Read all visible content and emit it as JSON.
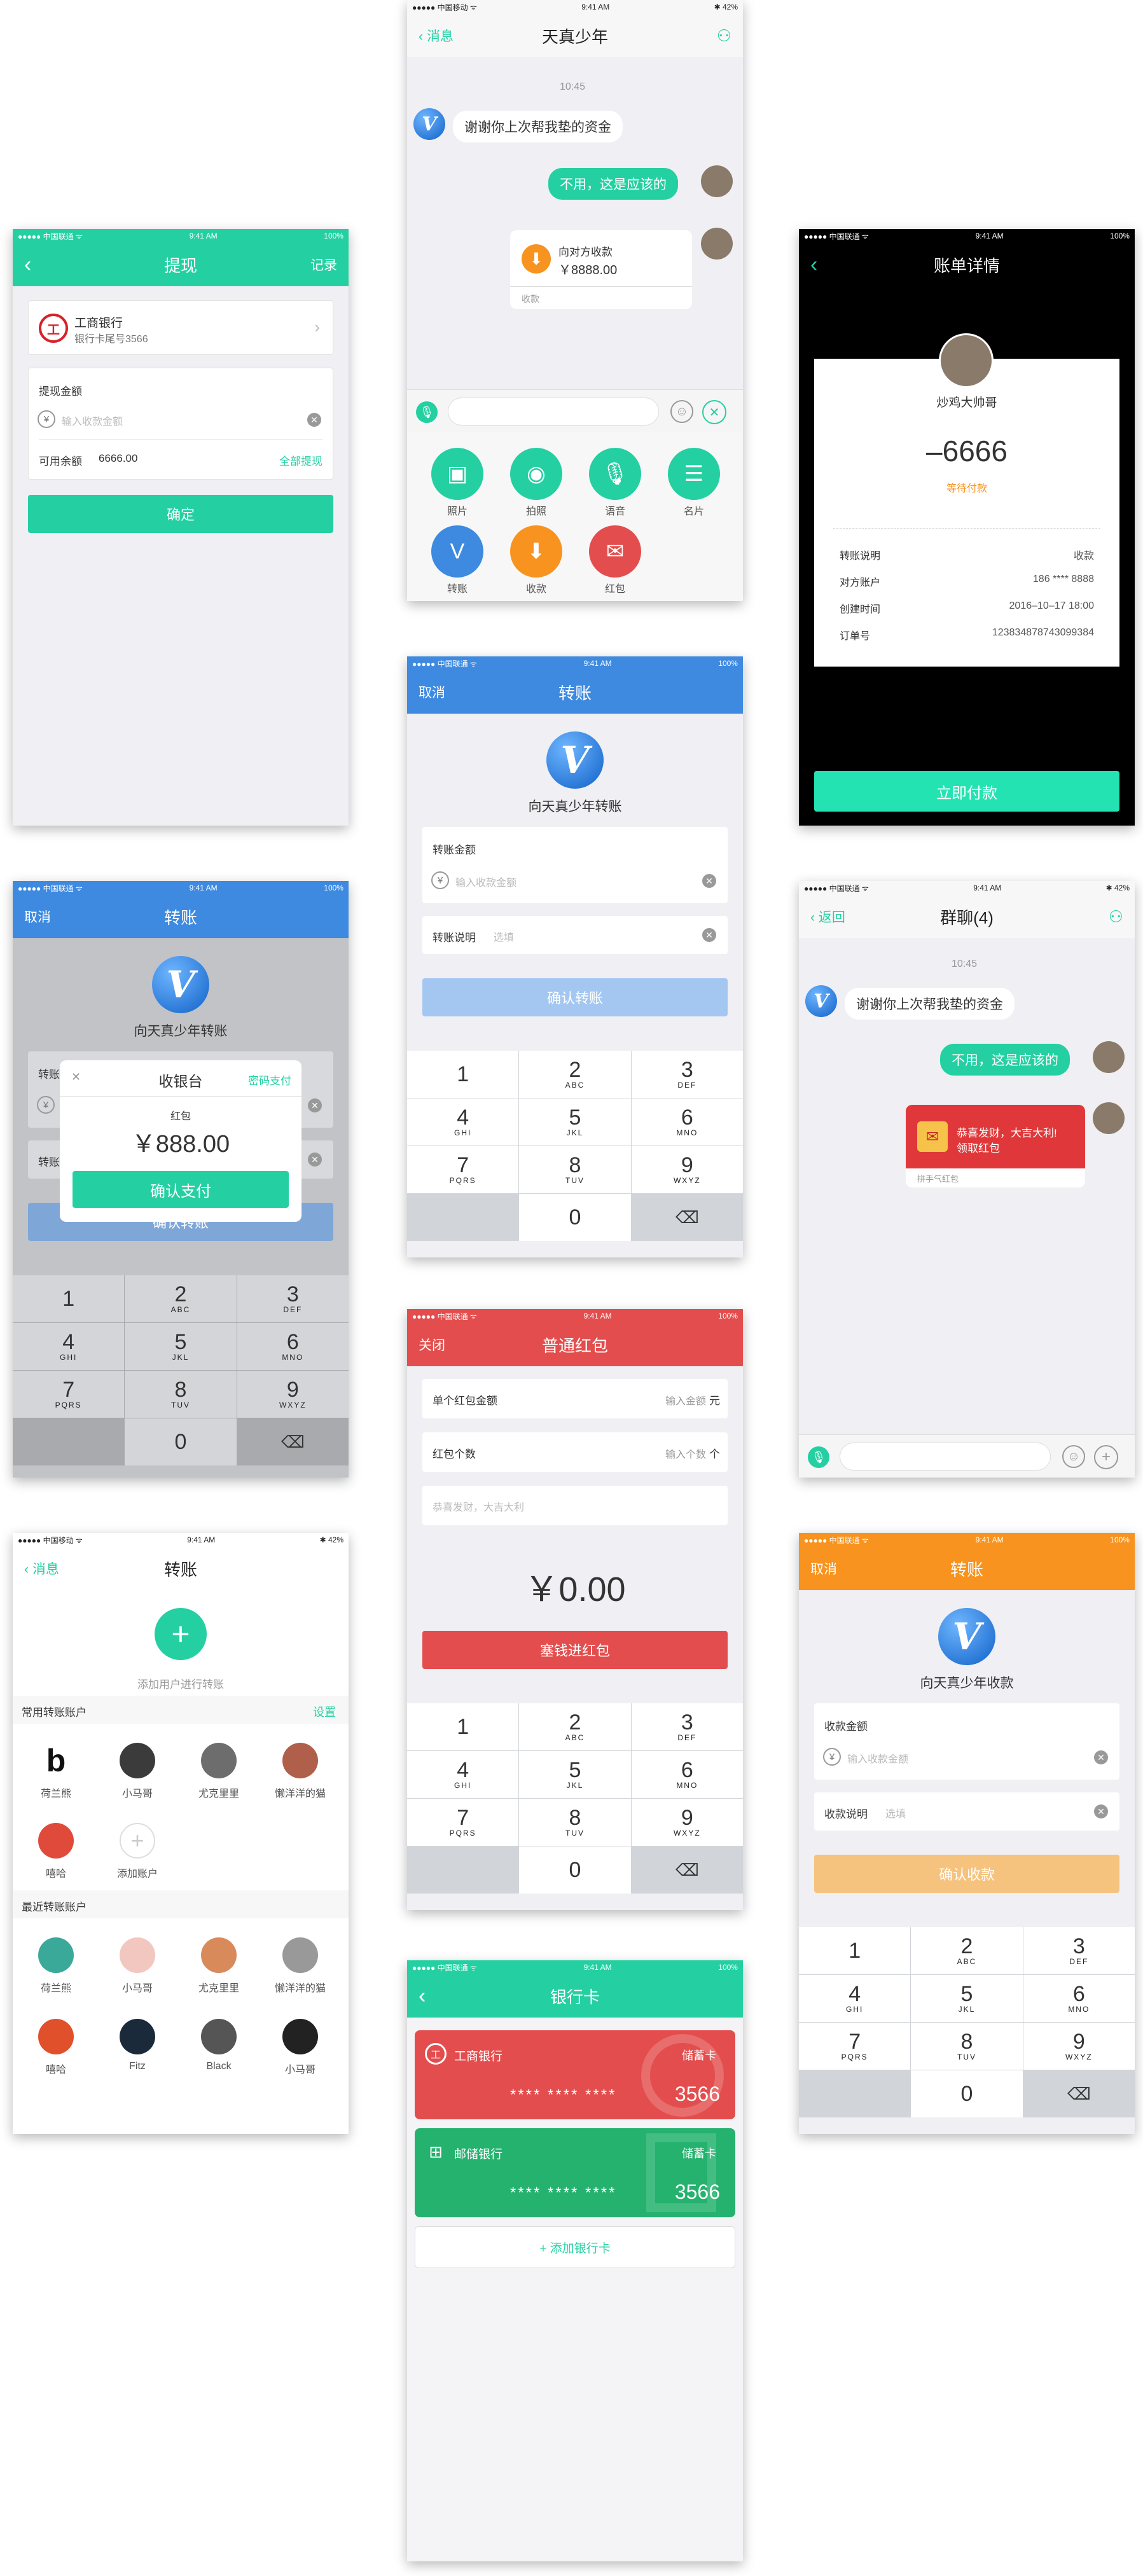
{
  "status": {
    "carrier_u": "●●●●● 中国联通 ᯤ",
    "carrier_m": "●●●●● 中国移动 ᯤ",
    "time": "9:41 AM",
    "battery": "100%",
    "battery42": "✱ 42%"
  },
  "withdraw": {
    "title": "提现",
    "back": "‹",
    "record": "记录",
    "bank_name": "工商银行",
    "bank_tail": "银行卡尾号3566",
    "amount_label": "提现金额",
    "amount_placeholder": "输入收款金额",
    "balance_label": "可用余额",
    "balance": "6666.00",
    "withdraw_all": "全部提现",
    "confirm": "确定"
  },
  "chat1": {
    "back": "消息",
    "title": "天真少年",
    "time": "10:45",
    "msg_in": "谢谢你上次帮我垫的资金",
    "msg_out": "不用，这是应该的",
    "req_title": "向对方收款",
    "req_amount": "￥8888.00",
    "req_tag": "收款",
    "tools": [
      "照片",
      "拍照",
      "语音",
      "名片",
      "转账",
      "收款",
      "红包"
    ]
  },
  "bill": {
    "title": "账单详情",
    "name": "炒鸡大帅哥",
    "amount": "–6666",
    "status": "等待付款",
    "rows": [
      [
        "转账说明",
        "收款"
      ],
      [
        "对方账户",
        "186 **** 8888"
      ],
      [
        "创建时间",
        "2016–10–17 18:00"
      ],
      [
        "订单号",
        "123834878743099384"
      ]
    ],
    "pay": "立即付款"
  },
  "transfer1": {
    "cancel": "取消",
    "title": "转账",
    "to": "向天真少年转账",
    "amount_label": "转账金额",
    "amount_placeholder": "输入收款金额",
    "note_label": "转账说明",
    "note_placeholder": "选填",
    "confirm": "确认转账"
  },
  "keypad": [
    [
      "1",
      ""
    ],
    [
      "2",
      "ABC"
    ],
    [
      "3",
      "DEF"
    ],
    [
      "4",
      "GHI"
    ],
    [
      "5",
      "JKL"
    ],
    [
      "6",
      "MNO"
    ],
    [
      "7",
      "PQRS"
    ],
    [
      "8",
      "TUV"
    ],
    [
      "9",
      "WXYZ"
    ],
    [
      "",
      ""
    ],
    [
      "0",
      ""
    ],
    [
      "⌫",
      ""
    ]
  ],
  "cashier": {
    "cancel": "取消",
    "title": "转账",
    "to": "向天真少年转账",
    "sheet_close": "✕",
    "sheet_title": "收银台",
    "pwd_pay": "密码支付",
    "item": "红包",
    "amount": "￥888.00",
    "confirm": "确认支付",
    "t1": "转账",
    "t2": "转账",
    "confirm_bg": "确认转账"
  },
  "group": {
    "back": "返回",
    "title": "群聊(4)",
    "time": "10:45",
    "msg_in": "谢谢你上次帮我垫的资金",
    "msg_out": "不用，这是应该的",
    "red_text1": "恭喜发财，大吉大利!",
    "red_text2": "领取红包",
    "red_tag": "拼手气红包"
  },
  "redpack": {
    "close": "关闭",
    "title": "普通红包",
    "single_label": "单个红包金额",
    "single_ph": "输入金额",
    "single_unit": "元",
    "count_label": "红包个数",
    "count_ph": "输入个数",
    "count_unit": "个",
    "wish_ph": "恭喜发财，大吉大利",
    "total": "￥0.00",
    "submit": "塞钱进红包"
  },
  "contacts": {
    "back": "消息",
    "title": "转账",
    "add_label": "添加用户进行转账",
    "frequent": "常用转账账户",
    "settings": "设置",
    "frequent_list": [
      "荷兰熊",
      "小马哥",
      "尤克里里",
      "懒洋洋的猫",
      "嘻哈",
      "添加账户"
    ],
    "recent": "最近转账账户",
    "recent_list": [
      "荷兰熊",
      "小马哥",
      "尤克里里",
      "懒洋洋的猫",
      "嘻哈",
      "Fitz",
      "Black",
      "小马哥"
    ]
  },
  "receive": {
    "cancel": "取消",
    "title": "转账",
    "to": "向天真少年收款",
    "amount_label": "收款金额",
    "amount_placeholder": "输入收款金额",
    "note_label": "收款说明",
    "note_placeholder": "选填",
    "confirm": "确认收款"
  },
  "cards": {
    "back": "‹",
    "title": "银行卡",
    "cards": [
      {
        "bank": "工商银行",
        "type": "储蓄卡",
        "num": "**** **** ****",
        "tail": "3566",
        "color": "#e34d4d"
      },
      {
        "bank": "邮储银行",
        "type": "储蓄卡",
        "num": "**** **** ****",
        "tail": "3566",
        "color": "#24b26e"
      }
    ],
    "add": "+ 添加银行卡"
  },
  "colors": {
    "green": "#24d0a2",
    "blue": "#3d8ae0",
    "red": "#e34d4d",
    "orange": "#f7931e"
  }
}
